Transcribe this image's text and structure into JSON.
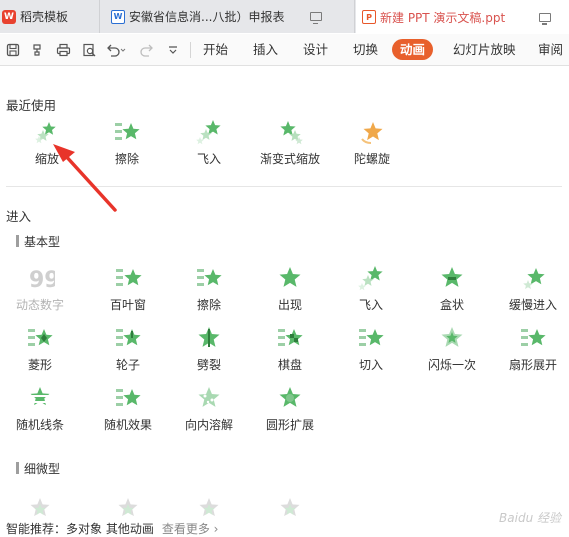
{
  "tabs": [
    {
      "label": "稻壳模板",
      "icon": "wps-logo-icon"
    },
    {
      "label": "安徽省信息消...八批）申报表",
      "icon": "word-doc-icon"
    },
    {
      "label": "新建 PPT 演示文稿.ppt",
      "icon": "ppt-doc-icon"
    }
  ],
  "ribbon": {
    "tabs": [
      "开始",
      "插入",
      "设计",
      "切换",
      "动画",
      "幻灯片放映",
      "审阅"
    ],
    "active": "动画"
  },
  "recent": {
    "title": "最近使用",
    "items": [
      "缩放",
      "擦除",
      "飞入",
      "渐变式缩放",
      "陀螺旋"
    ]
  },
  "entrance": {
    "title": "进入",
    "basic": {
      "title": "基本型",
      "rows": [
        [
          "动态数字",
          "百叶窗",
          "擦除",
          "出现",
          "飞入",
          "盒状",
          "缓慢进入"
        ],
        [
          "菱形",
          "轮子",
          "劈裂",
          "棋盘",
          "切入",
          "闪烁一次",
          "扇形展开"
        ],
        [
          "随机线条",
          "随机效果",
          "向内溶解",
          "圆形扩展"
        ]
      ]
    },
    "subtle": {
      "title": "细微型"
    }
  },
  "bottom": {
    "text": "智能推荐：多对象 其他动画",
    "more": "查看更多 ›"
  },
  "watermark": "Baidu 经验",
  "colors": {
    "accent": "#e8602c",
    "star_green": "#59b86a",
    "arrow_red": "#e8342a"
  }
}
